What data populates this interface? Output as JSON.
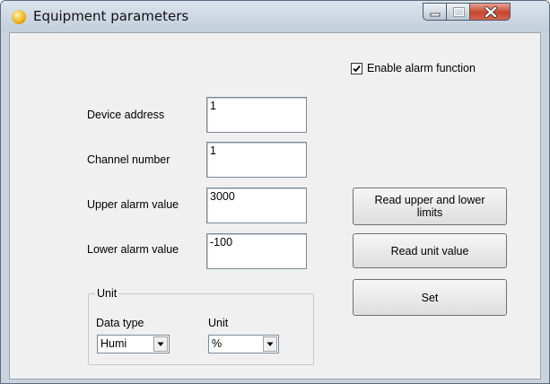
{
  "window": {
    "title": "Equipment parameters"
  },
  "alarm": {
    "enable_label": "Enable alarm function",
    "enabled": true
  },
  "fields": [
    {
      "label": "Device address",
      "value": "1"
    },
    {
      "label": "Channel number",
      "value": "1"
    },
    {
      "label": "Upper alarm value",
      "value": "3000"
    },
    {
      "label": "Lower alarm value",
      "value": "-100"
    }
  ],
  "buttons": {
    "read_limits": "Read upper and lower limits",
    "read_unit": "Read unit value",
    "set": "Set"
  },
  "unit_group": {
    "legend": "Unit",
    "data_type_label": "Data type",
    "data_type_value": "Humi",
    "unit_label": "Unit",
    "unit_value": "%"
  },
  "icons": {
    "app": "app-icon",
    "minimize": "minimize-icon",
    "maximize": "maximize-icon",
    "close": "close-icon",
    "dropdown": "chevron-down-icon",
    "check": "checkmark-icon"
  },
  "colors": {
    "titlebar": "#c9d3de",
    "client_bg": "#f0f0f0",
    "close_button": "#c7462e"
  }
}
